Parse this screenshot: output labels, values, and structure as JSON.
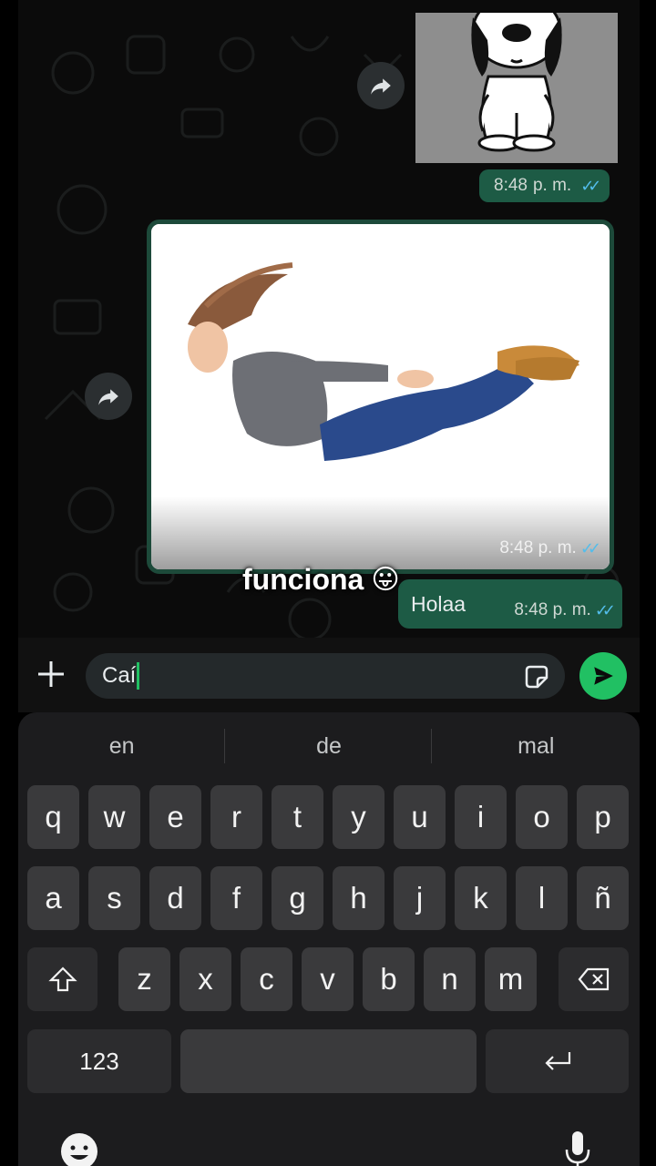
{
  "chat": {
    "image_messages": [
      {
        "time": "8:48",
        "ampm": "p. m."
      },
      {
        "time": "8:48",
        "ampm": "p. m."
      }
    ],
    "text_message": {
      "text": "Holaa",
      "time": "8:48",
      "ampm": "p. m."
    },
    "overlay_caption": "funciona",
    "overlay_emoji": "😛",
    "read_ticks": "✓✓"
  },
  "composer": {
    "value": "Caí",
    "icons": {
      "attach": "plus-icon",
      "sticker": "sticker-icon",
      "send": "send-icon"
    }
  },
  "keyboard": {
    "suggestions": [
      "en",
      "de",
      "mal"
    ],
    "row1": [
      "q",
      "w",
      "e",
      "r",
      "t",
      "y",
      "u",
      "i",
      "o",
      "p"
    ],
    "row2": [
      "a",
      "s",
      "d",
      "f",
      "g",
      "h",
      "j",
      "k",
      "l",
      "ñ"
    ],
    "row3": [
      "z",
      "x",
      "c",
      "v",
      "b",
      "n",
      "m"
    ],
    "numbers_key": "123",
    "icons": [
      "shift-icon",
      "backspace-icon",
      "return-icon",
      "emoji-icon",
      "microphone-icon"
    ]
  },
  "colors": {
    "accent": "#21c063",
    "bubble_out": "#1d5b45",
    "ticks": "#53bdeb",
    "key": "#3a3a3c"
  }
}
